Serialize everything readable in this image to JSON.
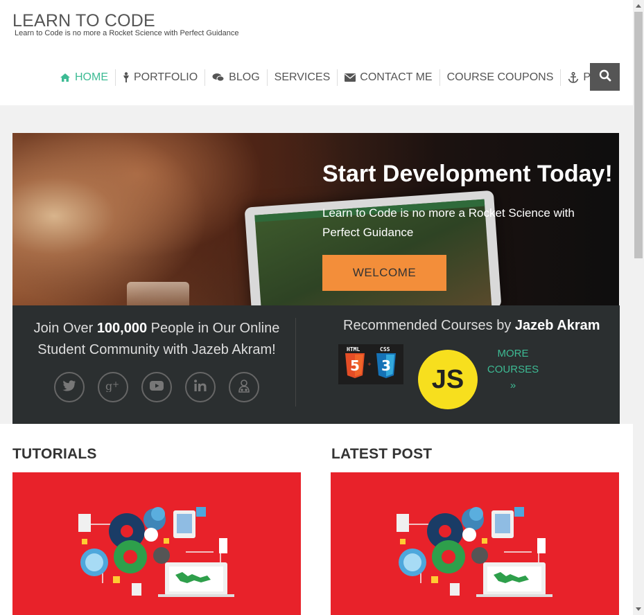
{
  "site": {
    "title": "LEARN TO CODE",
    "tagline": "Learn to Code is no more a Rocket Science with Perfect Guidance"
  },
  "nav": {
    "items": [
      {
        "label": "HOME",
        "icon": "home-icon",
        "active": true
      },
      {
        "label": "PORTFOLIO",
        "icon": "person-icon"
      },
      {
        "label": "BLOG",
        "icon": "comments-icon"
      },
      {
        "label": "SERVICES",
        "icon": ""
      },
      {
        "label": "CONTACT ME",
        "icon": "envelope-icon"
      },
      {
        "label": "COURSE COUPONS",
        "icon": ""
      },
      {
        "label": "PAQ",
        "icon": "anchor-icon"
      }
    ],
    "search_icon": "search-icon"
  },
  "hero": {
    "title": "Start Development Today!",
    "subtitle": "Learn to Code is no more a Rocket Science with Perfect Guidance",
    "button": "WELCOME"
  },
  "community": {
    "text_pre": "Join Over ",
    "text_bold": "100,000",
    "text_post": " People in Our Online Student Community with Jazeb Akram!",
    "social": [
      "twitter-icon",
      "google-plus-icon",
      "youtube-icon",
      "linkedin-icon",
      "user-group-icon"
    ]
  },
  "courses": {
    "heading_pre": "Recommended Courses by ",
    "heading_bold": "Jazeb Akram",
    "html_label": "HTML",
    "css_label": "CSS",
    "html_num": "5",
    "css_num": "3",
    "js_label": "JS",
    "more_line1": "MORE",
    "more_line2": "COURSES",
    "more_arrow": "»"
  },
  "sections": {
    "tutorials": "TUTORIALS",
    "latest": "LATEST POST"
  },
  "colors": {
    "accent": "#3dbb94",
    "orange": "#f38e3a",
    "dark_band": "#2b2f30",
    "card_red": "#e8222a",
    "js_yellow": "#f7df1e"
  }
}
